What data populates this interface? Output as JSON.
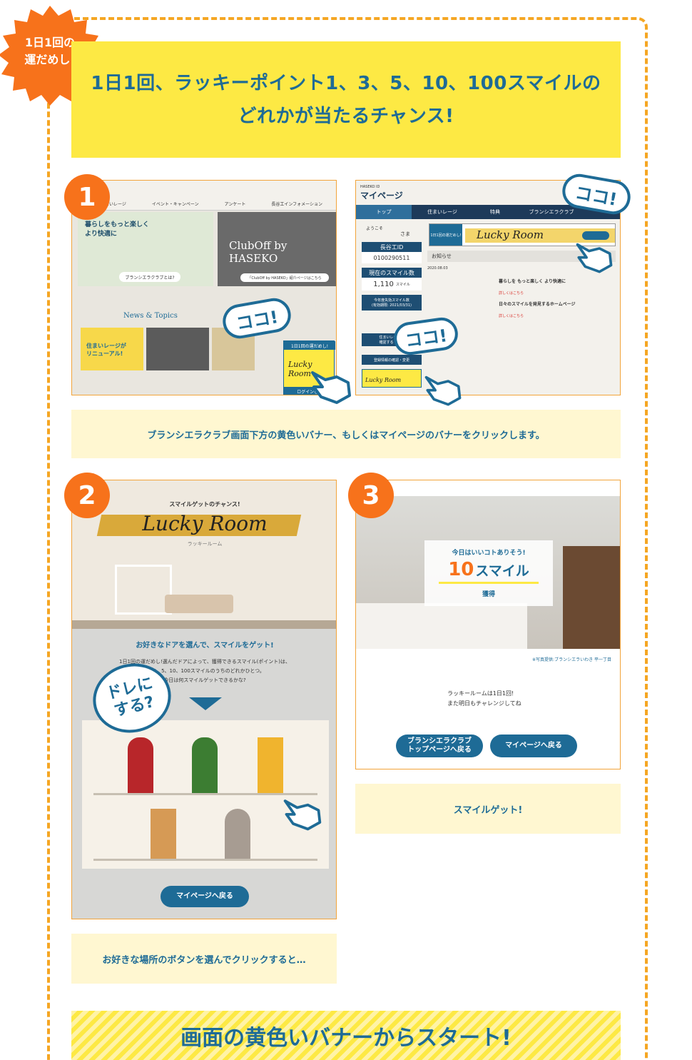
{
  "badge": {
    "line1": "1日1回の",
    "line2": "運だめし!"
  },
  "headline": {
    "line1": "1日1回、ラッキーポイント1、3、5、10、100スマイルの",
    "line2": "どれかが当たるチャンス!"
  },
  "step1": {
    "number": "1",
    "nav": [
      "住まいレージ",
      "イベント・キャンペーン",
      "アンケート",
      "長谷工インフォメーション"
    ],
    "hero_text": "暮らしをもっと楽しく\nより快適に",
    "hero_button": "ブランシエラクラブとは?",
    "cluboff": "ClubOff by HASEKO",
    "cluboff_link": "「ClubOff by HASEKO」紹介ページはこちら",
    "news_title": "News & Topics",
    "news_card_label": "住まいレージが\nリニューアル!",
    "banner_title": "1日1回の運だめし!",
    "banner_lucky": "Lucky Room",
    "login_label": "ログインして",
    "bubble": "ココ!"
  },
  "step1b": {
    "logo_small": "HASEKO ID",
    "mypage": "マイページ",
    "tabs": [
      "トップ",
      "住まいレージ",
      "特典",
      "ブランシエラクラブ"
    ],
    "welcome": "ようこそ",
    "sama": "さま",
    "id_label": "長谷工ID",
    "id_value": "0100290511",
    "smile_label": "現在のスマイル数",
    "smile_value": "1,110",
    "smile_unit": "スマイル",
    "expire_label": "今年度失効スマイル数\n(有効期限: 2021/03/31)",
    "lucky_banner": "Lucky Room",
    "lucky_banner_small": "1日1回の運だめし!",
    "notice_title": "お知らせ",
    "notice_date": "2020.08.03",
    "notice1_title": "暮らしを もっと楽しく より快適に",
    "notice1_link": "詳しくはこちら",
    "notice2_title": "日々のスマイルを発見するホームページ",
    "notice2_link": "詳しくはこちら",
    "side1": "住まいレージの\n確認する",
    "side2": "登録情報の確認・変更",
    "bottom_banner": "Lucky Room",
    "bubble1": "ココ!",
    "bubble2": "ココ!"
  },
  "caption1": "ブランシエラクラブ画面下方の黄色いバナー、もしくはマイページのバナーをクリックします。",
  "step2": {
    "number": "2",
    "sub_top": "スマイルゲットのチャンス!",
    "title": "Lucky Room",
    "kana": "ラッキールーム",
    "heading": "お好きなドアを選んで、スマイルをゲット!",
    "body1": "1日1回の運だめし!選んだドアによって、獲得できるスマイル(ポイント)は、",
    "body2": "1、3、5、10、100スマイルのうちのどれかひとつ。",
    "body3": "今日は何スマイルゲットできるかな?",
    "bubble": "ドレにする?",
    "back_button": "マイページへ戻る"
  },
  "caption2": "お好きな場所のボタンを選んでクリックすると…",
  "step3": {
    "number": "3",
    "result_top": "今日はいいコトありそう!",
    "result_amount": "10",
    "result_unit": "スマイル",
    "result_get": "獲得",
    "photo_credit": "※写真提供:ブランシエラいわき 平一丁目",
    "msg1": "ラッキールームは1日1回!",
    "msg2": "また明日もチャレンジしてね",
    "btn_club": "ブランシエラクラブ\nトップページへ戻る",
    "btn_mypage": "マイページへ戻る"
  },
  "caption3": "スマイルゲット!",
  "bottom_banner": "画面の黄色いバナーからスタート!",
  "colors": {
    "accent": "#1e6b96",
    "orange": "#f7721b",
    "yellow": "#fde944",
    "pale_yellow": "#fff7d1",
    "frame": "#f5a623"
  }
}
